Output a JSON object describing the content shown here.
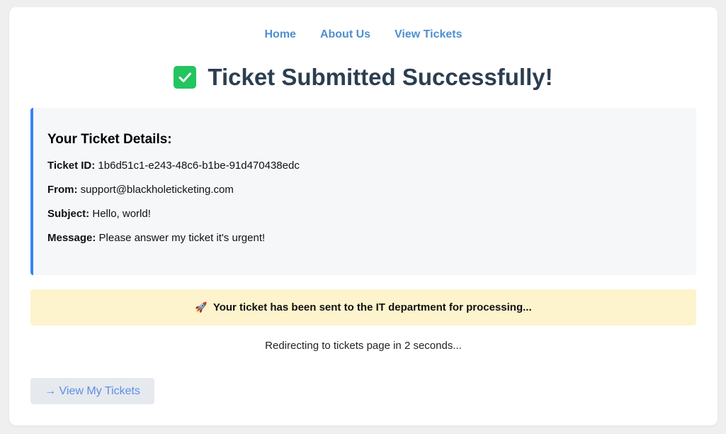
{
  "nav": {
    "items": [
      {
        "label": "Home"
      },
      {
        "label": "About Us"
      },
      {
        "label": "View Tickets"
      }
    ]
  },
  "header": {
    "title": "Ticket Submitted Successfully!",
    "icon": "check-box-icon"
  },
  "details": {
    "heading": "Your Ticket Details:",
    "ticket_id_label": "Ticket ID:",
    "ticket_id_value": "1b6d51c1-e243-48c6-b1be-91d470438edc",
    "from_label": "From:",
    "from_value": "support@blackholeticketing.com",
    "subject_label": "Subject:",
    "subject_value": "Hello, world!",
    "message_label": "Message:",
    "message_value": "Please answer my ticket it's urgent!"
  },
  "notice": {
    "icon": "rocket-icon",
    "icon_glyph": "🚀",
    "text": "Your ticket has been sent to the IT department for processing..."
  },
  "redirect": {
    "text": "Redirecting to tickets page in 2 seconds..."
  },
  "actions": {
    "view_tickets_label": "→ View My Tickets"
  },
  "colors": {
    "accent_blue": "#3b82f6",
    "nav_link": "#4f8fcf",
    "success_green": "#22c55e",
    "notice_bg": "#fdf3cd",
    "title_text": "#2c3e50"
  }
}
